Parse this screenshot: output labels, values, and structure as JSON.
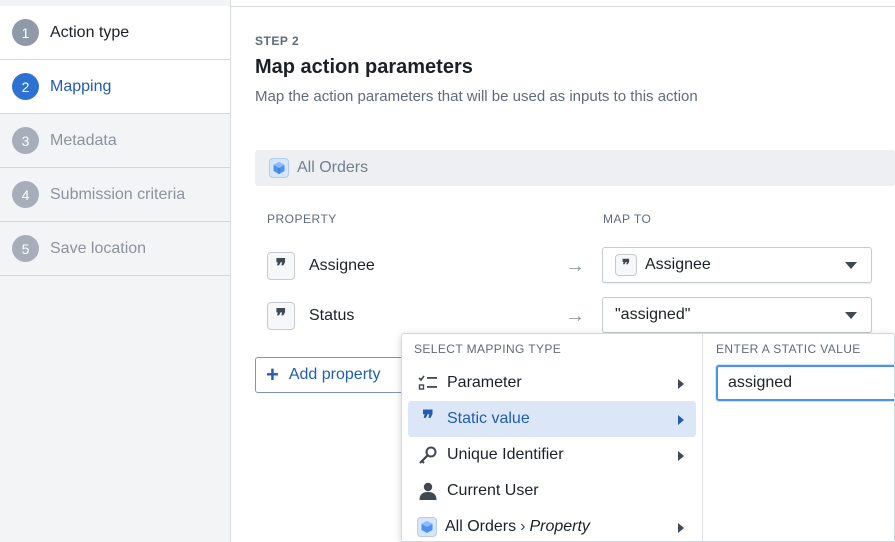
{
  "sidebar": {
    "steps": [
      {
        "num": "1",
        "label": "Action type",
        "state": "done"
      },
      {
        "num": "2",
        "label": "Mapping",
        "state": "active"
      },
      {
        "num": "3",
        "label": "Metadata",
        "state": "pending"
      },
      {
        "num": "4",
        "label": "Submission criteria",
        "state": "pending"
      },
      {
        "num": "5",
        "label": "Save location",
        "state": "pending"
      }
    ]
  },
  "header": {
    "step_tag": "STEP 2",
    "title": "Map action parameters",
    "subtitle": "Map the action parameters that will be used as inputs to this action"
  },
  "object": {
    "icon": "cube-icon",
    "label": "All Orders"
  },
  "mapping": {
    "property_header": "PROPERTY",
    "map_to_header": "MAP TO",
    "rows": [
      {
        "property": "Assignee",
        "property_icon": "quote-icon",
        "map_to": "Assignee",
        "map_to_icon": "quote-icon"
      },
      {
        "property": "Status",
        "property_icon": "quote-icon",
        "map_to": "\"assigned\"",
        "map_to_icon": ""
      }
    ],
    "add_property_label": "Add property"
  },
  "dropdown": {
    "header": "SELECT MAPPING TYPE",
    "items": [
      {
        "label": "Parameter",
        "icon": "parameter-list-icon",
        "has_submenu": true,
        "selected": false
      },
      {
        "label": "Static value",
        "icon": "quote-icon",
        "has_submenu": true,
        "selected": true
      },
      {
        "label": "Unique Identifier",
        "icon": "key-icon",
        "has_submenu": true,
        "selected": false
      },
      {
        "label": "Current User",
        "icon": "user-icon",
        "has_submenu": false,
        "selected": false
      },
      {
        "label": "All Orders",
        "path_suffix": "Property",
        "icon": "cube-icon",
        "has_submenu": true,
        "selected": false
      }
    ],
    "static_header": "ENTER A STATIC VALUE",
    "static_value": "assigned"
  },
  "colors": {
    "accent": "#2d72d2",
    "accent_text": "#215db0",
    "selected_bg": "#dbe7f7",
    "input_focus": "#4c90f0"
  }
}
